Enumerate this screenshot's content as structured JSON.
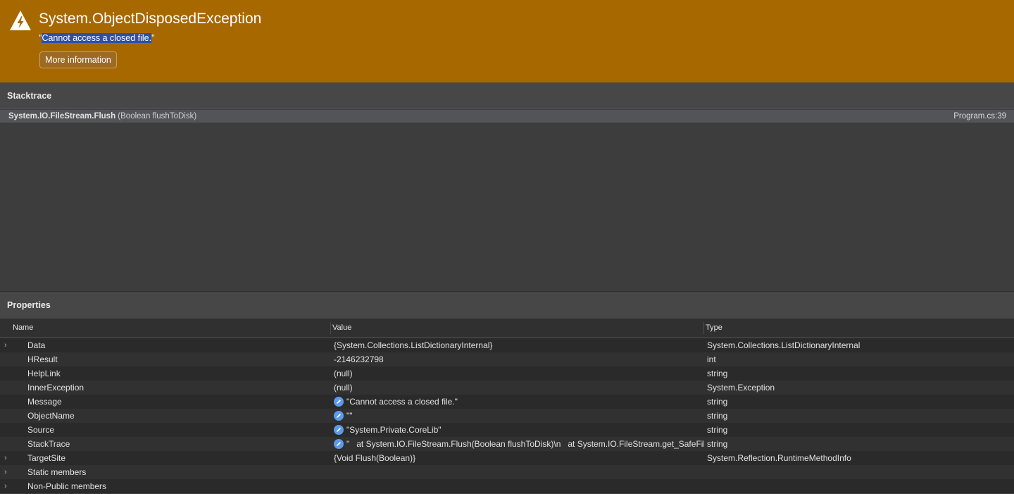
{
  "exception": {
    "title": "System.ObjectDisposedException",
    "message_open": "\"",
    "message": "Cannot access a closed file.",
    "message_close": "\"",
    "more_button": "More information"
  },
  "stacktrace": {
    "heading": "Stacktrace",
    "frames": [
      {
        "method": "System.IO.FileStream.Flush",
        "args": " (Boolean flushToDisk)",
        "location": "Program.cs:39"
      }
    ]
  },
  "properties": {
    "heading": "Properties",
    "columns": {
      "name": "Name",
      "value": "Value",
      "type": "Type"
    },
    "rows": [
      {
        "expandable": true,
        "name": "Data",
        "editable": false,
        "value": "{System.Collections.ListDictionaryInternal}",
        "type": "System.Collections.ListDictionaryInternal"
      },
      {
        "expandable": false,
        "name": "HResult",
        "editable": false,
        "value": "-2146232798",
        "type": "int"
      },
      {
        "expandable": false,
        "name": "HelpLink",
        "editable": false,
        "value": "(null)",
        "type": "string"
      },
      {
        "expandable": false,
        "name": "InnerException",
        "editable": false,
        "value": "(null)",
        "type": "System.Exception"
      },
      {
        "expandable": false,
        "name": "Message",
        "editable": true,
        "value": "\"Cannot access a closed file.\"",
        "type": "string"
      },
      {
        "expandable": false,
        "name": "ObjectName",
        "editable": true,
        "value": "\"\"",
        "type": "string"
      },
      {
        "expandable": false,
        "name": "Source",
        "editable": true,
        "value": "\"System.Private.CoreLib\"",
        "type": "string"
      },
      {
        "expandable": false,
        "name": "StackTrace",
        "editable": true,
        "value": "\"   at System.IO.FileStream.Flush(Boolean flushToDisk)\\n   at System.IO.FileStream.get_SafeFileHandle()",
        "type": "string"
      },
      {
        "expandable": true,
        "name": "TargetSite",
        "editable": false,
        "value": "{Void Flush(Boolean)}",
        "type": "System.Reflection.RuntimeMethodInfo"
      },
      {
        "expandable": true,
        "name": "Static members",
        "editable": false,
        "value": "",
        "type": ""
      },
      {
        "expandable": true,
        "name": "Non-Public members",
        "editable": false,
        "value": "",
        "type": ""
      }
    ]
  },
  "icons": {
    "warning": "warning-icon",
    "expand": "chevron-right-icon",
    "edit": "pencil-icon"
  },
  "colors": {
    "banner": "#a86800",
    "selection": "#2f4fa6",
    "edit_icon": "#5b9bea"
  }
}
